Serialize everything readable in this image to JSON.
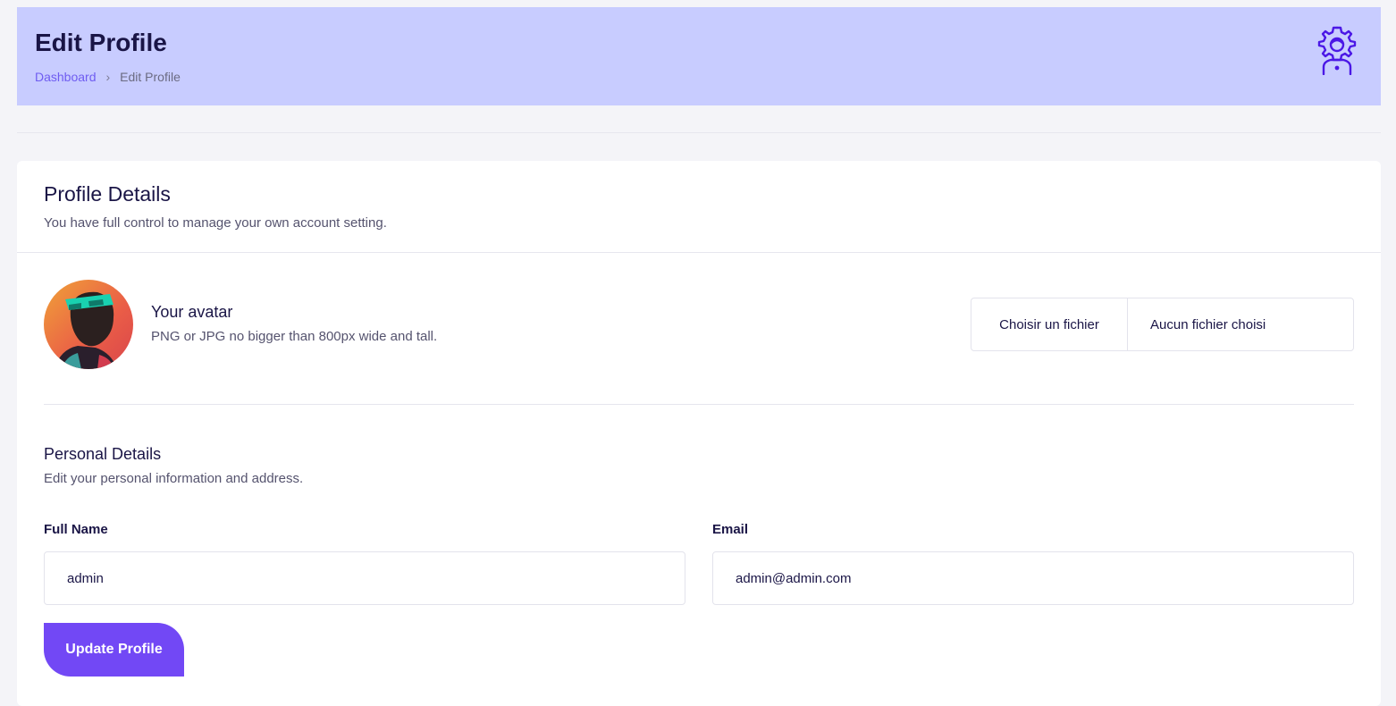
{
  "header": {
    "title": "Edit Profile",
    "breadcrumb": {
      "home": "Dashboard",
      "separator": "›",
      "current": "Edit Profile"
    },
    "icon": "user-gear-icon"
  },
  "card": {
    "title": "Profile Details",
    "subtitle": "You have full control to manage your own account setting."
  },
  "avatar": {
    "title": "Your avatar",
    "hint": "PNG or JPG no bigger than 800px wide and tall.",
    "file_button": "Choisir un fichier",
    "file_status": "Aucun fichier choisi"
  },
  "personal": {
    "title": "Personal Details",
    "subtitle": "Edit your personal information and address.",
    "full_name_label": "Full Name",
    "full_name_value": "admin",
    "email_label": "Email",
    "email_value": "admin@admin.com"
  },
  "actions": {
    "update_label": "Update Profile"
  },
  "colors": {
    "accent": "#7248f5",
    "header_bg": "#c8ccff",
    "link": "#6f5cf1"
  }
}
